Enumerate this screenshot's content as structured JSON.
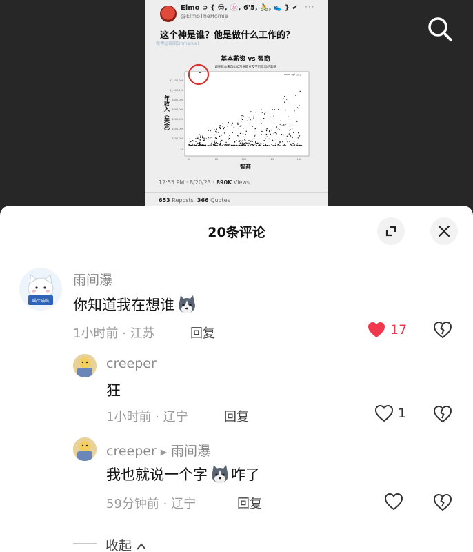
{
  "tweet": {
    "display_name": "Elmo",
    "handle": "@ElmoTheHomie",
    "question": "这个神是谁？他是做什么工作的？",
    "watermark": "微博@泰国Emmanuel",
    "timestamp": "12:55 PM · 8/20/23 ·",
    "views_count": "890K",
    "views_label": "Views",
    "reposts_count": "653",
    "reposts_label": "Reposts",
    "quotes_count": "366",
    "quotes_label": "Quotes",
    "chart": {
      "title": "基本薪资 vs 智商",
      "subtitle": "调查样本来自450万份职业及学历信息的美籍",
      "xlabel": "智商",
      "ylabel": "年收入（美金）",
      "circle_color": "#d9342b"
    }
  },
  "sheet": {
    "title": "20条评论"
  },
  "comments": [
    {
      "username": "雨间瀑",
      "text": "你知道我在想谁",
      "emoji": "husky-emoji",
      "meta": "1小时前 · 江苏",
      "reply_label": "回复",
      "likes": "17",
      "liked": true
    },
    {
      "username": "creeper",
      "text": "狂",
      "meta": "1小时前 · 辽宁",
      "reply_label": "回复",
      "likes": "1",
      "liked": false
    },
    {
      "username": "creeper",
      "reply_to": "雨间瀑",
      "text_before": "我也就说一个字",
      "text_after": "咋了",
      "emoji": "husky-emoji",
      "meta": "59分钟前 · 辽宁",
      "reply_label": "回复",
      "likes": "",
      "liked": false
    }
  ],
  "collapse_label": "收起",
  "colors": {
    "like_active": "#f0384f",
    "sheet_bg": "#ffffff",
    "backdrop": "#272727"
  }
}
